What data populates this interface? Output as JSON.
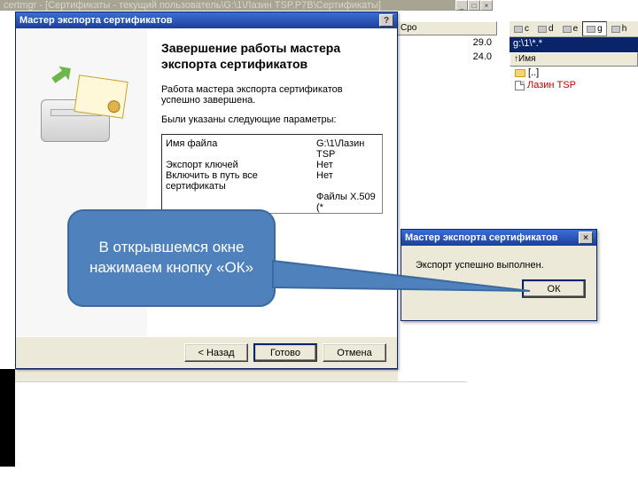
{
  "certmgr": {
    "title": "certmgr - [Сертификаты - текущий пользователь\\G:\\1\\Лазин TSP.P7B\\Сертификаты]"
  },
  "file_manager": {
    "drives": [
      "c",
      "d",
      "e",
      "g",
      "h"
    ],
    "active_drive_index": 3,
    "path_label": "g:\\1\\*.*",
    "column_header": "↑Имя",
    "up_label": "[..]",
    "files": [
      {
        "name": "Лазин TSP",
        "highlighted": true
      }
    ]
  },
  "mid_panel": {
    "header": "Сро",
    "rows": [
      "29.0",
      "24.0"
    ]
  },
  "wizard": {
    "window_title": "Мастер экспорта сертификатов",
    "help_label": "?",
    "heading": "Завершение работы мастера экспорта сертификатов",
    "message": "Работа мастера экспорта сертификатов успешно завершена.",
    "params_label": "Были указаны следующие параметры:",
    "rows": [
      {
        "k": "Имя файла",
        "v": "G:\\1\\Лазин TSP"
      },
      {
        "k": "Экспорт ключей",
        "v": "Нет"
      },
      {
        "k": "Включить в путь все сертификаты",
        "v": "Нет"
      },
      {
        "k": "",
        "v": "Файлы X.509 (*"
      }
    ],
    "buttons": {
      "back": "< Назад",
      "finish": "Готово",
      "cancel": "Отмена"
    }
  },
  "callout": {
    "text": "В открывшемся окне нажимаем кнопку «ОК»"
  },
  "confirm": {
    "window_title": "Мастер экспорта сертификатов",
    "message": "Экспорт успешно выполнен.",
    "ok_label": "ОК",
    "close_label": "×"
  }
}
